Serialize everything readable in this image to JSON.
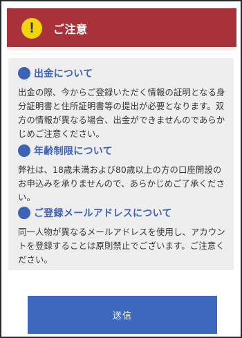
{
  "colors": {
    "header_bg": "#a8313a",
    "header_strip": "#fdeaea",
    "warn_icon_bg": "#f2d40c",
    "accent_blue": "#3d63b5",
    "notice_bg": "#eeeeee",
    "button_bg": "#3e68c0"
  },
  "header": {
    "icon": "exclamation-warning-icon",
    "icon_glyph": "!",
    "title": "ご注意"
  },
  "sections": [
    {
      "icon": "blue-circle-bullet-icon",
      "title": "出金について",
      "body": "出金の際、今からご登録いただく情報の証明となる身分証明書と住所証明書等の提出が必要となります。双方の情報が異なる場合、出金ができませんのであらかじめご注意ください。"
    },
    {
      "icon": "blue-circle-bullet-icon",
      "title": "年齢制限について",
      "body": "弊社は、18歳未満および80歳以上の方の口座開設のお申込みを承りませんので、あらかじめご了承ください。"
    },
    {
      "icon": "blue-circle-bullet-icon",
      "title": "ご登録メールアドレスについて",
      "body": "同一人物が異なるメールアドレスを使用し、アカウントを登録することは原則禁止でございます。ご注意ください。"
    }
  ],
  "submit": {
    "label": "送信"
  }
}
